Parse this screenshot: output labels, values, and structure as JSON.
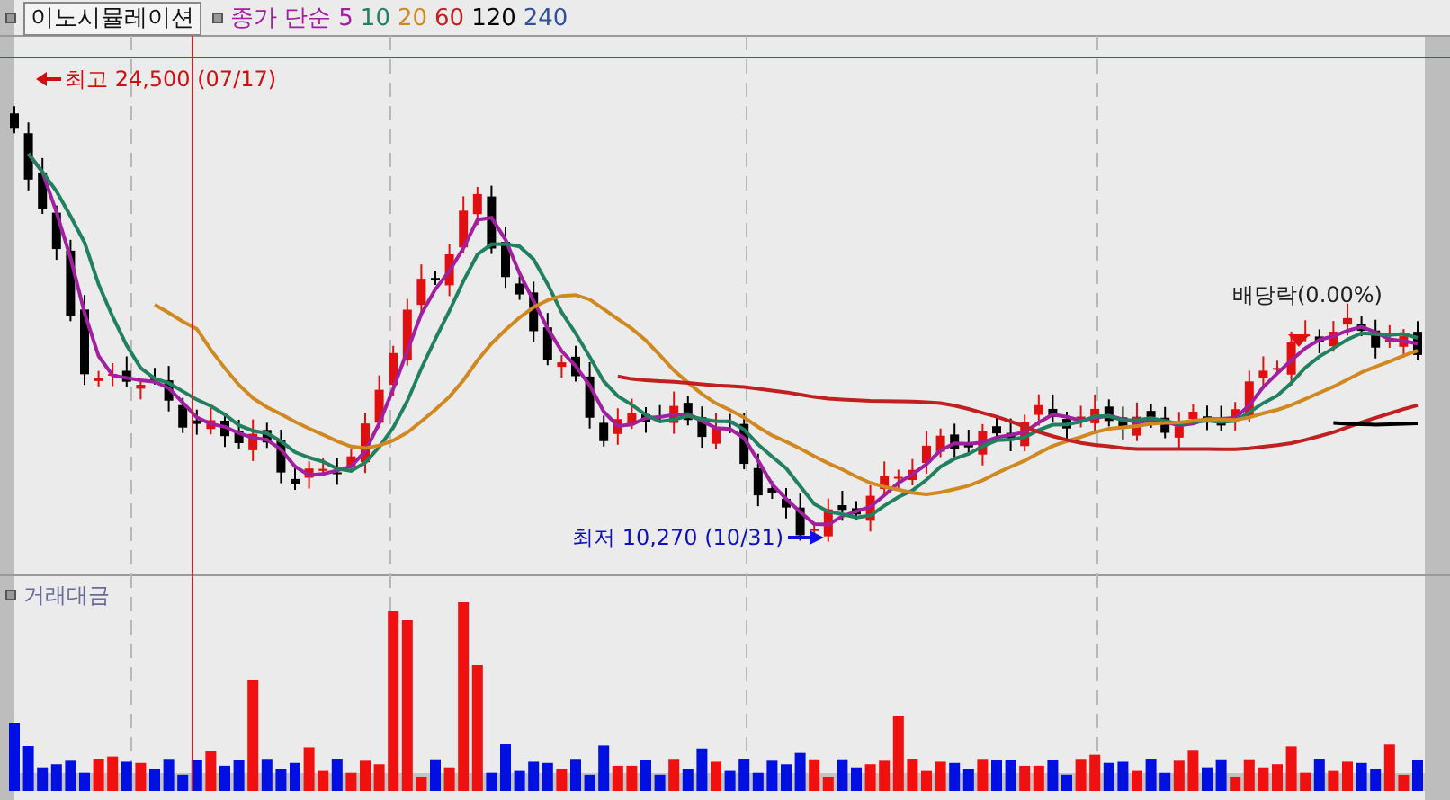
{
  "header": {
    "title": "이노시뮬레이션",
    "legend_label": "종가 단순",
    "moving_averages": [
      {
        "label": "5",
        "color": "#a020a0"
      },
      {
        "label": "10",
        "color": "#208060"
      },
      {
        "label": "20",
        "color": "#d08820"
      },
      {
        "label": "60",
        "color": "#c02020"
      },
      {
        "label": "120",
        "color": "#000000"
      },
      {
        "label": "240",
        "color": "#3050a0"
      }
    ]
  },
  "price_chart": {
    "annotations": [
      {
        "kind": "high",
        "text": "최고 24,500 (07/17)"
      },
      {
        "kind": "low",
        "text": "최저 10,270 (10/31)"
      },
      {
        "kind": "event",
        "text": "배당락(0.00%)"
      }
    ]
  },
  "volume_chart": {
    "title": "거래대금"
  }
}
